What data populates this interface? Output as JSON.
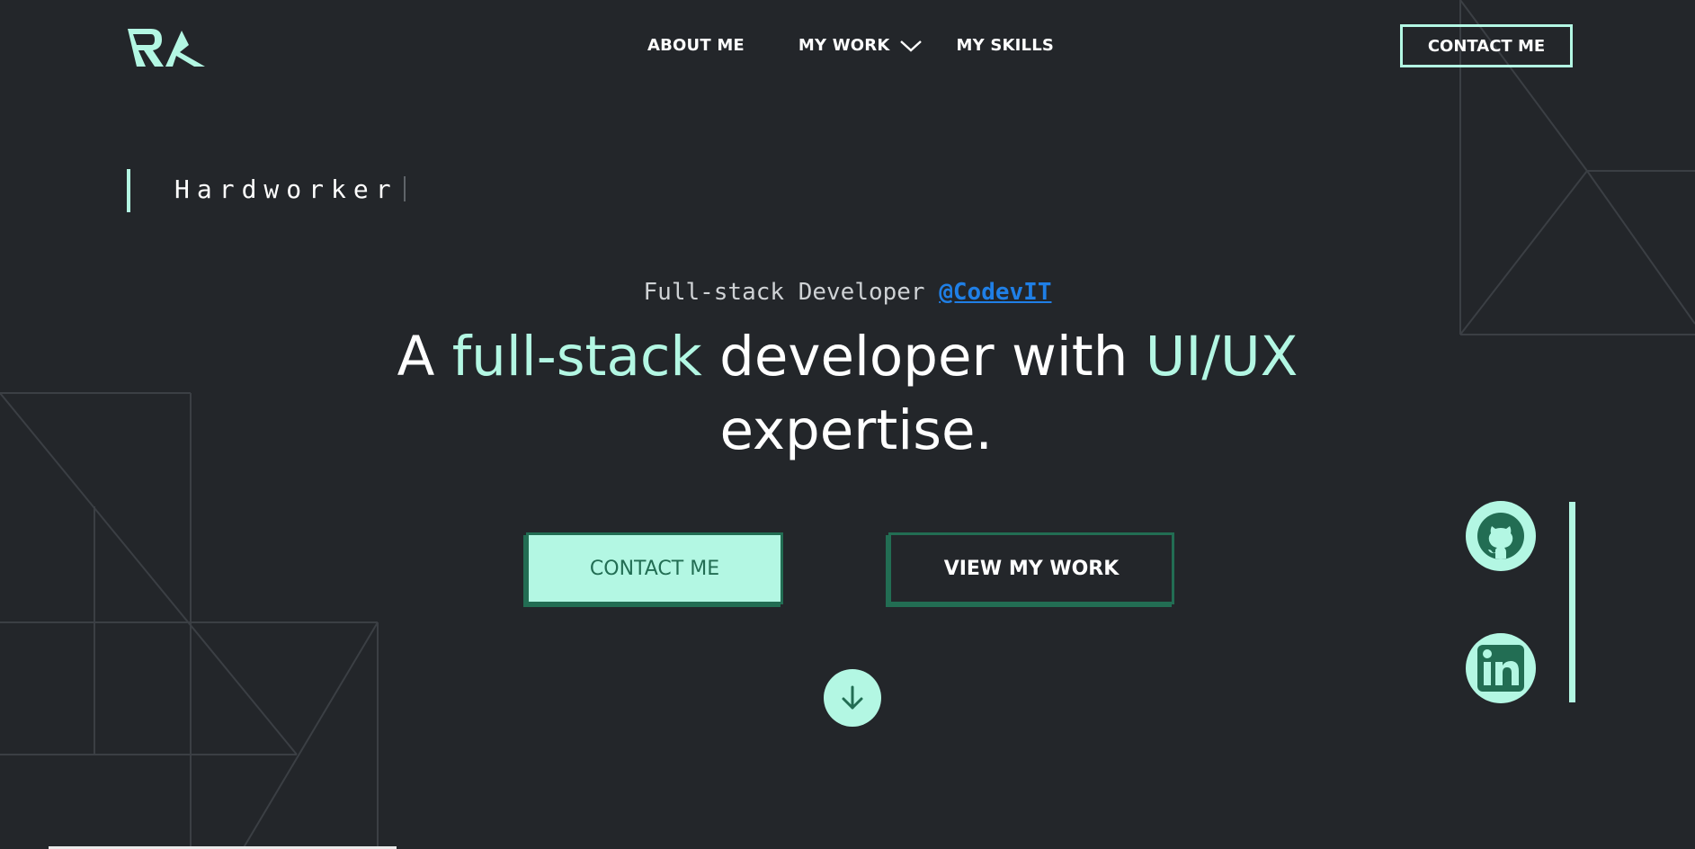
{
  "brand": {
    "logo_alt": "RA",
    "accent": "#b3f7e3",
    "dark_accent": "#226d53",
    "background": "#23262a",
    "link": "#1f7fe6"
  },
  "nav": {
    "items": [
      {
        "label": "ABOUT ME"
      },
      {
        "label": "MY WORK",
        "icon": "chevron-down-icon"
      },
      {
        "label": "MY SKILLS"
      }
    ],
    "contact_label": "CONTACT ME"
  },
  "typing": {
    "word": "Hardworker"
  },
  "hero": {
    "subtitle_prefix": "Full-stack Developer ",
    "subtitle_handle": "@CodevIT",
    "headline_parts": [
      "A ",
      "full-stack",
      " developer with ",
      "UI/UX",
      " expertise."
    ],
    "primary_button": "CONTACT ME",
    "secondary_button": "VIEW MY WORK",
    "scroll_icon": "arrow-down-icon"
  },
  "social": {
    "items": [
      {
        "name": "github",
        "icon": "github-icon"
      },
      {
        "name": "linkedin",
        "icon": "linkedin-icon"
      }
    ]
  }
}
